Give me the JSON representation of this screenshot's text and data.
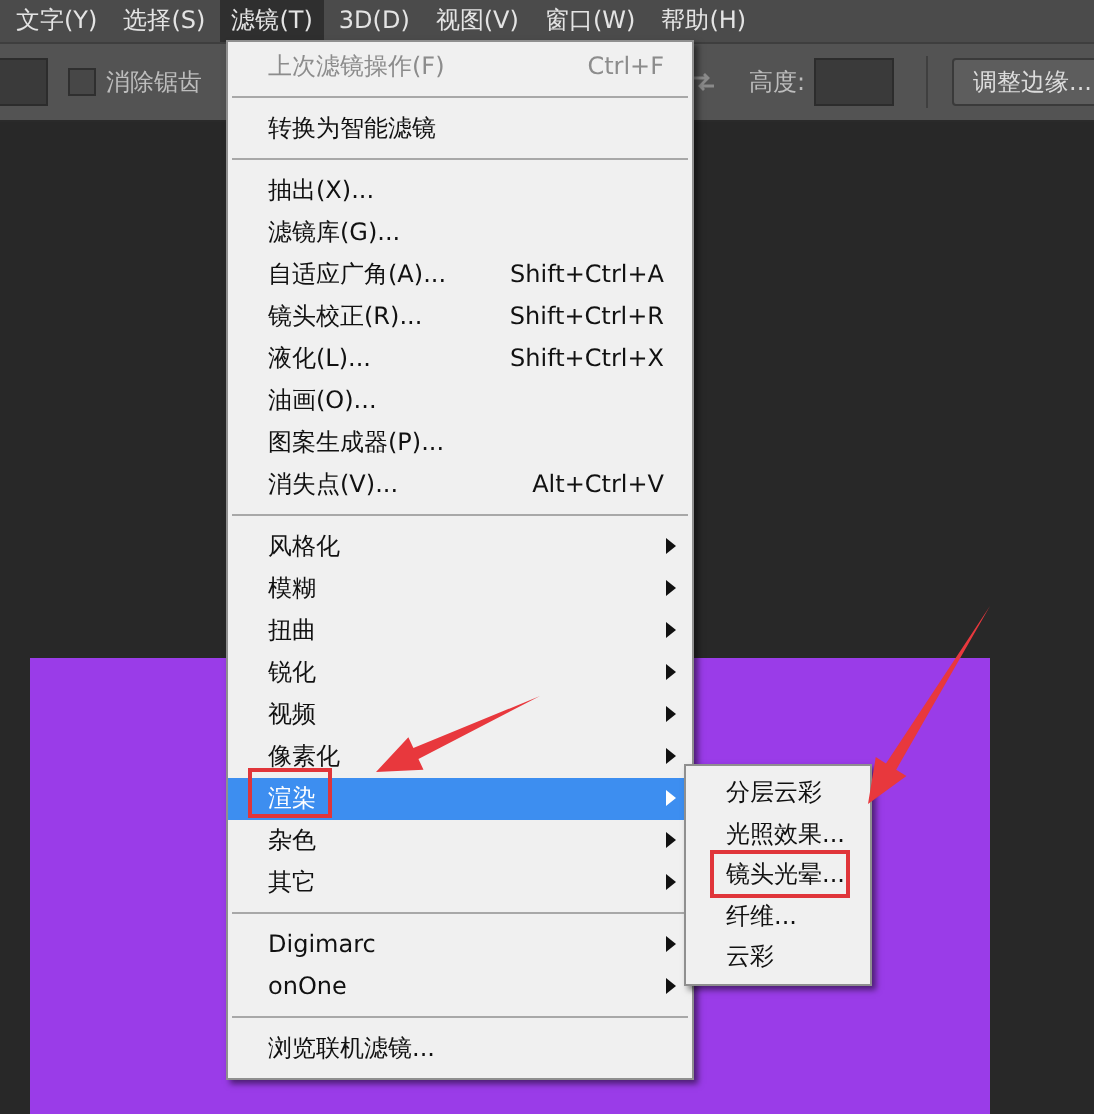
{
  "menu_bar": {
    "items": [
      {
        "label": "文字(Y)",
        "selected": false
      },
      {
        "label": "选择(S)",
        "selected": false
      },
      {
        "label": "滤镜(T)",
        "selected": true
      },
      {
        "label": "3D(D)",
        "selected": false
      },
      {
        "label": "视图(V)",
        "selected": false
      },
      {
        "label": "窗口(W)",
        "selected": false
      },
      {
        "label": "帮助(H)",
        "selected": false
      }
    ]
  },
  "options_bar": {
    "antialias": {
      "label": "消除锯齿",
      "checked": false
    },
    "height_label": "高度:",
    "refine_button": "调整边缘..."
  },
  "filter_menu": {
    "items": [
      {
        "kind": "item",
        "label": "上次滤镜操作(F)",
        "shortcut": "Ctrl+F",
        "disabled": true,
        "submenu": false,
        "selected": false
      },
      {
        "kind": "separator"
      },
      {
        "kind": "item",
        "label": "转换为智能滤镜",
        "disabled": false,
        "submenu": false,
        "selected": false
      },
      {
        "kind": "separator"
      },
      {
        "kind": "item",
        "label": "抽出(X)...",
        "disabled": false,
        "submenu": false,
        "selected": false
      },
      {
        "kind": "item",
        "label": "滤镜库(G)...",
        "disabled": false,
        "submenu": false,
        "selected": false
      },
      {
        "kind": "item",
        "label": "自适应广角(A)...",
        "shortcut": "Shift+Ctrl+A",
        "disabled": false,
        "submenu": false,
        "selected": false
      },
      {
        "kind": "item",
        "label": "镜头校正(R)...",
        "shortcut": "Shift+Ctrl+R",
        "disabled": false,
        "submenu": false,
        "selected": false
      },
      {
        "kind": "item",
        "label": "液化(L)...",
        "shortcut": "Shift+Ctrl+X",
        "disabled": false,
        "submenu": false,
        "selected": false
      },
      {
        "kind": "item",
        "label": "油画(O)...",
        "disabled": false,
        "submenu": false,
        "selected": false
      },
      {
        "kind": "item",
        "label": "图案生成器(P)...",
        "disabled": false,
        "submenu": false,
        "selected": false
      },
      {
        "kind": "item",
        "label": "消失点(V)...",
        "shortcut": "Alt+Ctrl+V",
        "disabled": false,
        "submenu": false,
        "selected": false
      },
      {
        "kind": "separator"
      },
      {
        "kind": "item",
        "label": "风格化",
        "disabled": false,
        "submenu": true,
        "selected": false
      },
      {
        "kind": "item",
        "label": "模糊",
        "disabled": false,
        "submenu": true,
        "selected": false
      },
      {
        "kind": "item",
        "label": "扭曲",
        "disabled": false,
        "submenu": true,
        "selected": false
      },
      {
        "kind": "item",
        "label": "锐化",
        "disabled": false,
        "submenu": true,
        "selected": false
      },
      {
        "kind": "item",
        "label": "视频",
        "disabled": false,
        "submenu": true,
        "selected": false
      },
      {
        "kind": "item",
        "label": "像素化",
        "disabled": false,
        "submenu": true,
        "selected": false
      },
      {
        "kind": "item",
        "label": "渲染",
        "disabled": false,
        "submenu": true,
        "selected": true
      },
      {
        "kind": "item",
        "label": "杂色",
        "disabled": false,
        "submenu": true,
        "selected": false
      },
      {
        "kind": "item",
        "label": "其它",
        "disabled": false,
        "submenu": true,
        "selected": false
      },
      {
        "kind": "separator"
      },
      {
        "kind": "item",
        "label": "Digimarc",
        "disabled": false,
        "submenu": true,
        "selected": false
      },
      {
        "kind": "item",
        "label": "onOne",
        "disabled": false,
        "submenu": true,
        "selected": false
      },
      {
        "kind": "separator"
      },
      {
        "kind": "item",
        "label": "浏览联机滤镜...",
        "disabled": false,
        "submenu": false,
        "selected": false
      }
    ]
  },
  "render_submenu": {
    "items": [
      {
        "label": "分层云彩"
      },
      {
        "label": "光照效果..."
      },
      {
        "label": "镜头光晕..."
      },
      {
        "label": "纤维..."
      },
      {
        "label": "云彩"
      }
    ]
  }
}
